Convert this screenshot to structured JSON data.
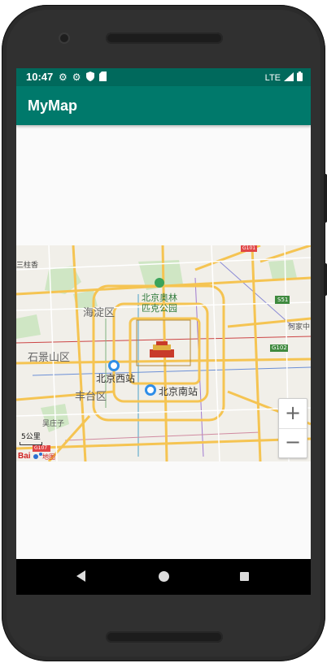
{
  "status_bar": {
    "time": "10:47",
    "icons": [
      "gear-icon",
      "gear-icon",
      "shield-icon",
      "sd-card-icon"
    ],
    "network": "LTE",
    "signal_icon": "signal-icon",
    "battery_icon": "battery-icon"
  },
  "app_bar": {
    "title": "MyMap",
    "color": "#00796b"
  },
  "map": {
    "labels": {
      "sanzhuang": "三柱香",
      "olympic_park_line1": "北京奥林",
      "olympic_park_line2": "匹克公园",
      "haidian": "海淀区",
      "shijingshan": "石景山区",
      "beijing_west": "北京西站",
      "fengtai": "丰台区",
      "beijing_south": "北京南站",
      "hejia": "何家中",
      "wuzhuang": "吴庄子",
      "g101": "G101",
      "s51": "S51",
      "g102": "G102",
      "g107": "G107",
      "baidu": "Bai",
      "baidu_suffix": "地图"
    },
    "scale_text": "5公里",
    "zoom_in_label": "+",
    "zoom_out_label": "−"
  },
  "nav_bar": {
    "back_icon": "back-icon",
    "home_icon": "home-icon",
    "recents_icon": "recents-icon"
  }
}
